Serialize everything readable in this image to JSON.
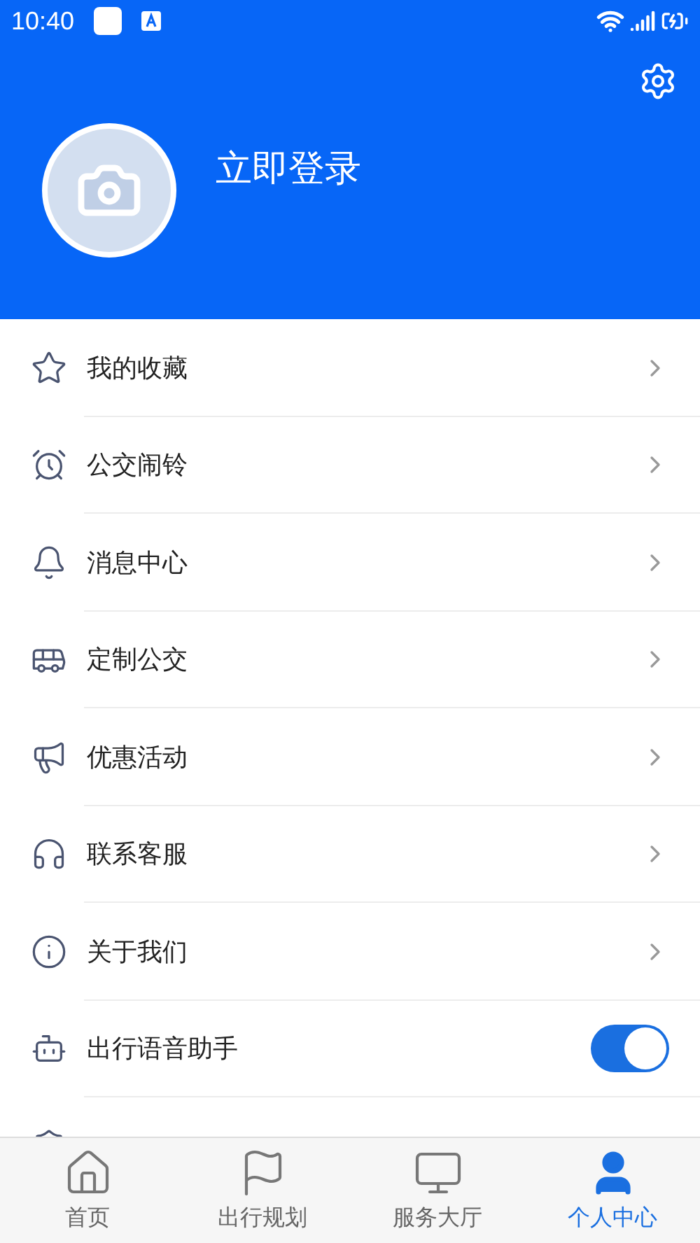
{
  "status_bar": {
    "time": "10:40"
  },
  "profile": {
    "login_text": "立即登录"
  },
  "menu": [
    {
      "kind": "link",
      "label": "我的收藏"
    },
    {
      "kind": "link",
      "label": "公交闹铃"
    },
    {
      "kind": "link",
      "label": "消息中心"
    },
    {
      "kind": "link",
      "label": "定制公交"
    },
    {
      "kind": "link",
      "label": "优惠活动"
    },
    {
      "kind": "link",
      "label": "联系客服"
    },
    {
      "kind": "link",
      "label": "关于我们"
    },
    {
      "kind": "toggle",
      "label": "出行语音助手",
      "on": true
    }
  ],
  "tab_bar": [
    {
      "label": "首页",
      "selected": false
    },
    {
      "label": "出行规划",
      "selected": false
    },
    {
      "label": "服务大厅",
      "selected": false
    },
    {
      "label": "个人中心",
      "selected": true
    }
  ]
}
